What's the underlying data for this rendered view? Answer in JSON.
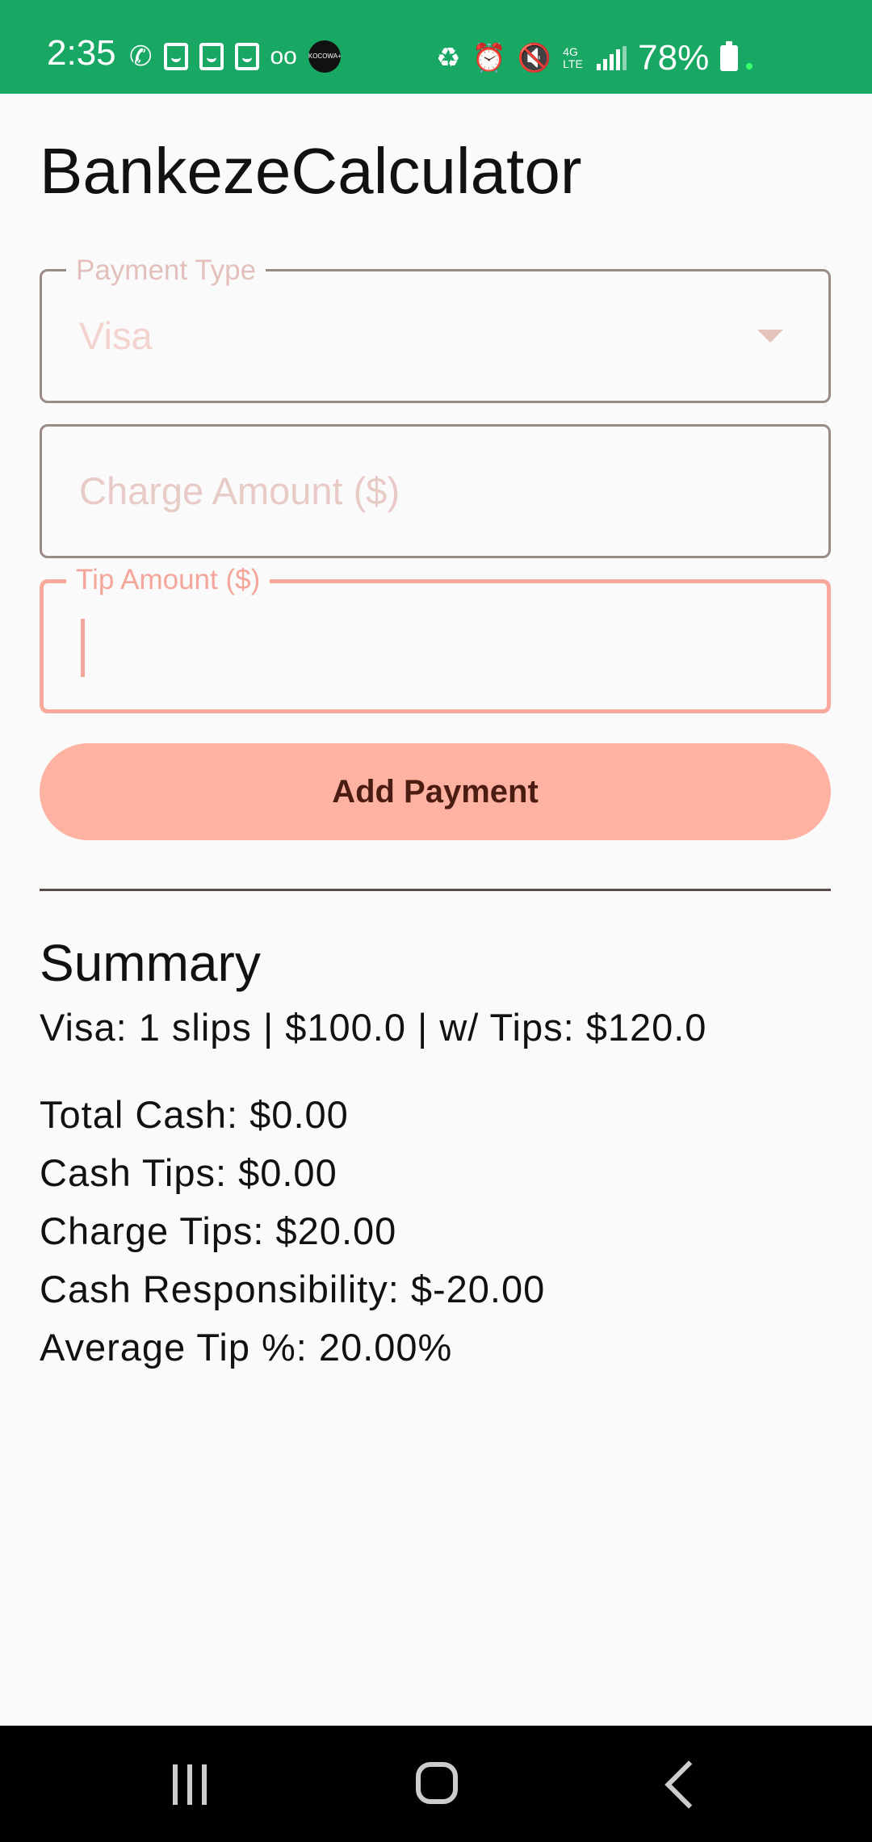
{
  "status_bar": {
    "time": "2:35",
    "battery_percent": "78%",
    "kocowa_label": "KOCOWA+",
    "network_label": "4G LTE",
    "left_icons": [
      "phone-icon",
      "notification-icon",
      "notification-icon",
      "notification-icon",
      "voicemail-icon",
      "kocowa-app-icon"
    ],
    "right_icons": [
      "battery-saver-icon",
      "alarm-icon",
      "mute-icon",
      "network-4g-icon",
      "signal-icon",
      "battery-icon"
    ],
    "background_color": "#18a864"
  },
  "app": {
    "title": "BankezeCalculator"
  },
  "form": {
    "payment_type": {
      "label": "Payment Type",
      "value": "Visa"
    },
    "charge_amount": {
      "placeholder": "Charge Amount ($)",
      "value": ""
    },
    "tip_amount": {
      "label": "Tip Amount ($)",
      "value": "",
      "focused": true
    },
    "add_button_label": "Add Payment",
    "accent_color": "#ffb2a2"
  },
  "summary": {
    "title": "Summary",
    "visa_line": "Visa: 1 slips | $100.0 | w/ Tips: $120.0",
    "total_cash": "Total Cash: $0.00",
    "cash_tips": "Cash Tips: $0.00",
    "charge_tips": "Charge Tips: $20.00",
    "cash_responsibility": "Cash Responsibility: $-20.00",
    "average_tip": "Average Tip %: 20.00%"
  },
  "nav_bar": {
    "buttons": [
      "recents-icon",
      "home-icon",
      "back-icon"
    ]
  }
}
